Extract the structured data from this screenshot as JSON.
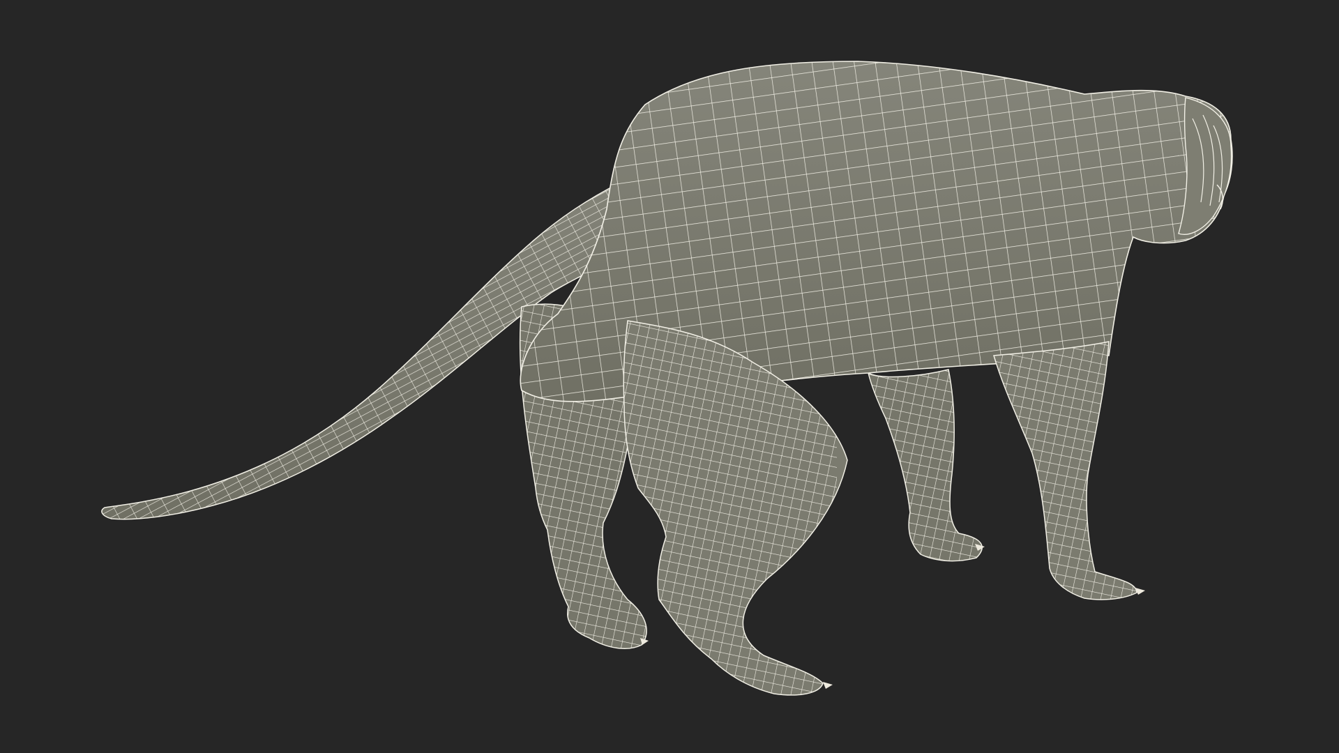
{
  "scene": {
    "background_color": "#262626",
    "mesh_fill_color": "#7b7b6e",
    "mesh_shadow_color": "#6a6a5f",
    "wire_color": "#f2f0e6",
    "claw_color": "#eeeade"
  }
}
